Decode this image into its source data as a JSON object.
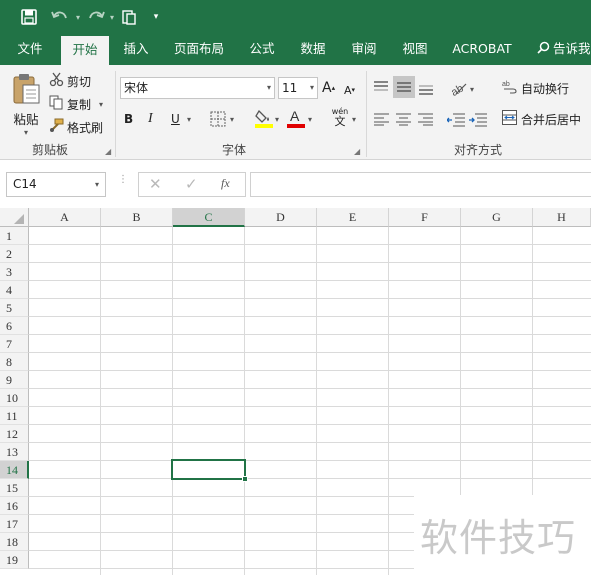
{
  "quick_access": {
    "save_icon": "save-icon",
    "undo_icon": "undo-icon",
    "redo_icon": "redo-icon",
    "clipboard_icon": "clipboard-icon",
    "customize_icon": "customize-dropdown-icon"
  },
  "tabs": [
    {
      "label": "文件"
    },
    {
      "label": "开始",
      "active": true
    },
    {
      "label": "插入"
    },
    {
      "label": "页面布局"
    },
    {
      "label": "公式"
    },
    {
      "label": "数据"
    },
    {
      "label": "审阅"
    },
    {
      "label": "视图"
    },
    {
      "label": "ACROBAT"
    },
    {
      "label": "告诉我"
    }
  ],
  "ribbon": {
    "clipboard": {
      "paste": "粘贴",
      "cut": "剪切",
      "copy": "复制",
      "format_painter": "格式刷",
      "group_label": "剪贴板"
    },
    "font": {
      "font_name": "宋体",
      "font_size": "11",
      "bold": "B",
      "italic": "I",
      "underline": "U",
      "phonetic_top": "wén",
      "phonetic_bottom": "文",
      "group_label": "字体"
    },
    "alignment": {
      "wrap_text": "自动换行",
      "merge_center": "合并后居中",
      "group_label": "对齐方式"
    }
  },
  "formula_bar": {
    "name_box": "C14",
    "fx": "fx",
    "formula": ""
  },
  "sheet": {
    "columns": [
      "A",
      "B",
      "C",
      "D",
      "E",
      "F",
      "G",
      "H"
    ],
    "rows": [
      "1",
      "2",
      "3",
      "4",
      "5",
      "6",
      "7",
      "8",
      "9",
      "10",
      "11",
      "12",
      "13",
      "14",
      "15",
      "16",
      "17",
      "18",
      "19"
    ],
    "active_column": "C",
    "active_row": "14"
  },
  "watermark": "软件技巧",
  "colors": {
    "accent": "#217346",
    "ribbon_bg": "#f3f3f3"
  }
}
